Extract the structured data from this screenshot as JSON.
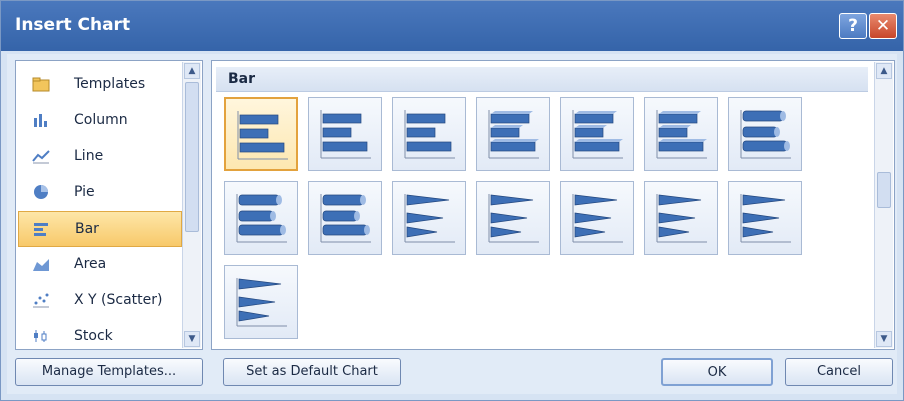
{
  "window": {
    "title": "Insert Chart",
    "help": "?",
    "close": "✕"
  },
  "categories": [
    {
      "label": "Templates",
      "icon": "folder-icon"
    },
    {
      "label": "Column",
      "icon": "column-chart-icon"
    },
    {
      "label": "Line",
      "icon": "line-chart-icon"
    },
    {
      "label": "Pie",
      "icon": "pie-chart-icon"
    },
    {
      "label": "Bar",
      "icon": "bar-chart-icon",
      "selected": true
    },
    {
      "label": "Area",
      "icon": "area-chart-icon"
    },
    {
      "label": "X Y (Scatter)",
      "icon": "scatter-chart-icon"
    },
    {
      "label": "Stock",
      "icon": "stock-chart-icon"
    }
  ],
  "gallery": {
    "section_title": "Bar",
    "thumbnails": [
      "clustered-bar",
      "stacked-bar",
      "100-stacked-bar",
      "clustered-bar-3d",
      "stacked-bar-3d",
      "100-stacked-bar-3d",
      "clustered-horizontal-cylinder",
      "stacked-horizontal-cylinder",
      "100-stacked-horizontal-cylinder",
      "clustered-horizontal-cone",
      "stacked-horizontal-cone",
      "100-stacked-horizontal-cone",
      "clustered-horizontal-pyramid",
      "stacked-horizontal-pyramid",
      "100-stacked-horizontal-pyramid"
    ],
    "selected_index": 0
  },
  "buttons": {
    "manage_templates": "Manage Templates...",
    "set_default": "Set as Default Chart",
    "ok": "OK",
    "cancel": "Cancel"
  },
  "scroll_arrows": {
    "up": "▲",
    "down": "▼"
  },
  "colors": {
    "accent": "#3564a9",
    "selection": "#f8c96a",
    "bar_blue": "#3d6fb6"
  }
}
